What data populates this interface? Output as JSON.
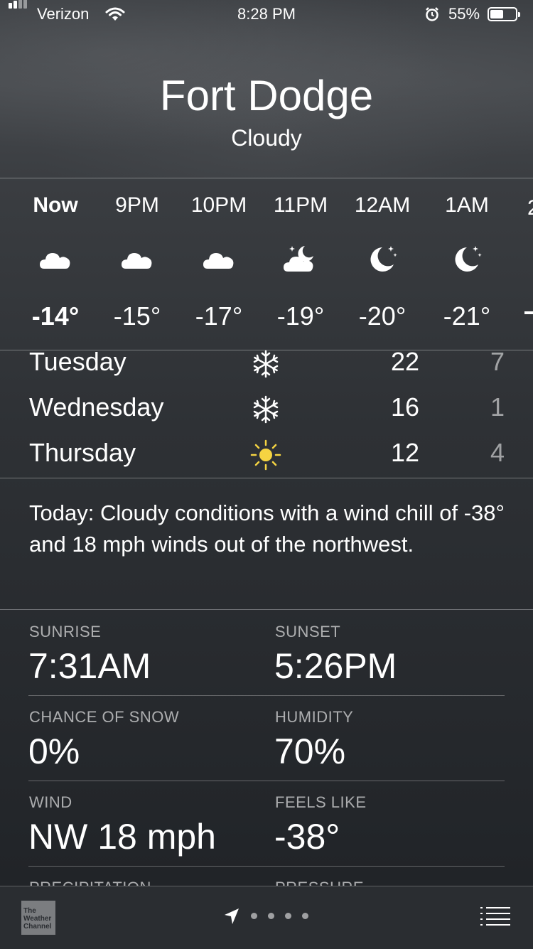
{
  "status_bar": {
    "carrier": "Verizon",
    "time": "8:28 PM",
    "battery_percent": "55%"
  },
  "location": {
    "city": "Fort Dodge",
    "condition": "Cloudy"
  },
  "hourly": [
    {
      "time": "Now",
      "icon": "cloud-icon",
      "temp": "-14°"
    },
    {
      "time": "9PM",
      "icon": "cloud-icon",
      "temp": "-15°"
    },
    {
      "time": "10PM",
      "icon": "cloud-icon",
      "temp": "-17°"
    },
    {
      "time": "11PM",
      "icon": "partly-cloudy-night-icon",
      "temp": "-19°"
    },
    {
      "time": "12AM",
      "icon": "moon-icon",
      "temp": "-20°"
    },
    {
      "time": "1AM",
      "icon": "moon-icon",
      "temp": "-21°"
    }
  ],
  "daily": [
    {
      "day": "Tuesday",
      "icon": "snowflake-icon",
      "high": "22",
      "low": "7"
    },
    {
      "day": "Wednesday",
      "icon": "snowflake-icon",
      "high": "16",
      "low": "1"
    },
    {
      "day": "Thursday",
      "icon": "sun-icon",
      "high": "12",
      "low": "4"
    }
  ],
  "summary": "Today: Cloudy conditions with a wind chill of -38° and 18 mph winds out of the northwest.",
  "details": {
    "sunrise_label": "SUNRISE",
    "sunrise_value": "7:31AM",
    "sunset_label": "SUNSET",
    "sunset_value": "5:26PM",
    "snow_label": "CHANCE OF SNOW",
    "snow_value": "0%",
    "humidity_label": "HUMIDITY",
    "humidity_value": "70%",
    "wind_label": "WIND",
    "wind_value": "NW 18 mph",
    "feels_label": "FEELS LIKE",
    "feels_value": "-38°",
    "precip_label": "PRECIPITATION",
    "pressure_label": "PRESSURE"
  },
  "bottom_bar": {
    "logo_text": "The Weather Channel",
    "page_count": 4,
    "active_page": "location"
  }
}
